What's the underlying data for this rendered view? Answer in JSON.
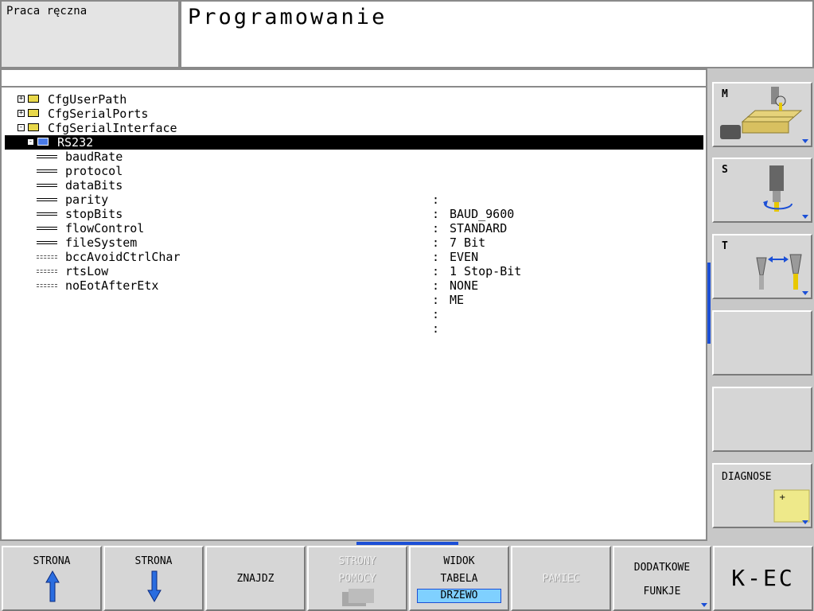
{
  "header": {
    "mode": "Praca ręczna",
    "title": "Programowanie"
  },
  "tree": {
    "nodes": [
      {
        "label": "CfgUserPath",
        "expander": "+"
      },
      {
        "label": "CfgSerialPorts",
        "expander": "+"
      },
      {
        "label": "CfgSerialInterface",
        "expander": "-"
      },
      {
        "label": "RS232",
        "expander": "-",
        "selected": true
      }
    ],
    "params": [
      {
        "name": "baudRate",
        "sep": ":",
        "value": "BAUD_9600"
      },
      {
        "name": "protocol",
        "sep": ":",
        "value": "STANDARD"
      },
      {
        "name": "dataBits",
        "sep": ":",
        "value": "7 Bit"
      },
      {
        "name": "parity",
        "sep": ":",
        "value": "EVEN"
      },
      {
        "name": "stopBits",
        "sep": ":",
        "value": "1 Stop-Bit"
      },
      {
        "name": "flowControl",
        "sep": ":",
        "value": "NONE"
      },
      {
        "name": "fileSystem",
        "sep": ":",
        "value": "ME"
      },
      {
        "name": "bccAvoidCtrlChar",
        "sep": ":",
        "value": ""
      },
      {
        "name": "rtsLow",
        "sep": ":",
        "value": ""
      },
      {
        "name": "noEotAfterEtx",
        "sep": ":",
        "value": ""
      }
    ]
  },
  "side_softkeys": {
    "m": "M",
    "s": "S",
    "t": "T",
    "diagnose": "DIAGNOSE"
  },
  "softkeys": {
    "page_up": "STRONA",
    "page_down": "STRONA",
    "find": "ZNAJDZ",
    "help_1": "STRONY",
    "help_2": "POMOCY",
    "view_1": "WIDOK",
    "view_2": "TABELA",
    "view_3": "DRZEWO",
    "memory": "PAMIEC",
    "extra_1": "DODATKOWE",
    "extra_2": "FUNKJE",
    "kec": "K-EC"
  },
  "colors": {
    "accent": "#1b4fd6",
    "panel": "#d6d6d6",
    "selection": "#000000"
  }
}
